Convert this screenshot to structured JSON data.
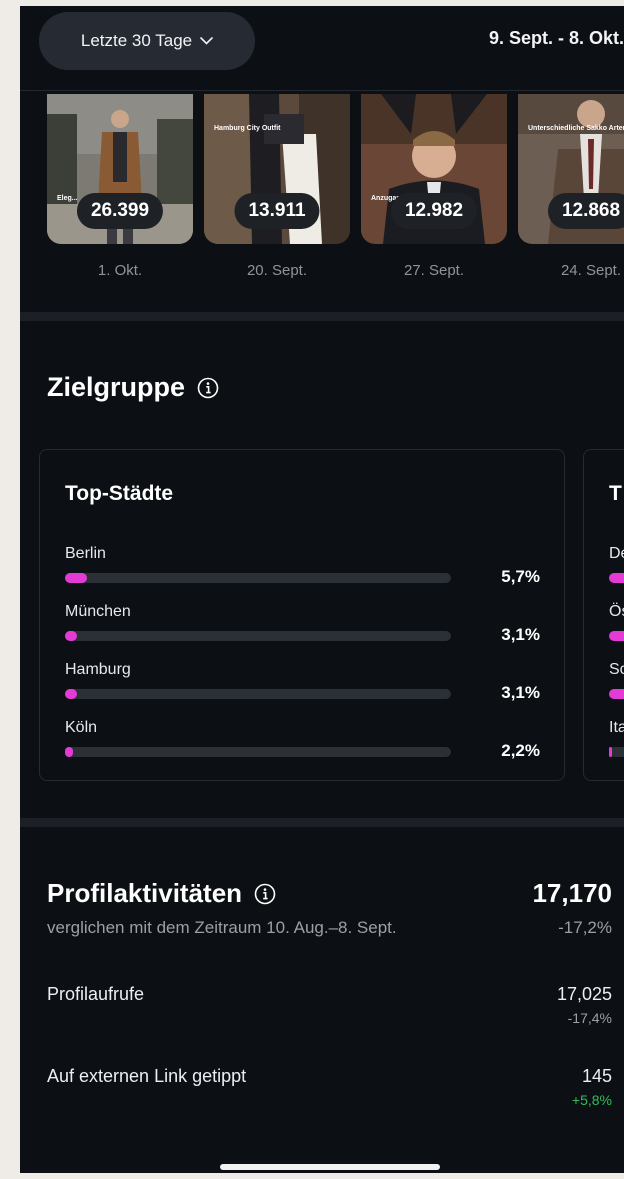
{
  "header": {
    "range_label": "Letzte 30 Tage",
    "date_range": "9. Sept. - 8. Okt."
  },
  "reels": [
    {
      "views": "26.399",
      "date": "1. Okt.",
      "caption": "Eleg..."
    },
    {
      "views": "13.911",
      "date": "20. Sept.",
      "caption": "Hamburg City Outfit"
    },
    {
      "views": "12.982",
      "date": "27. Sept.",
      "caption": "Anzuganalyse Neal Caffrey"
    },
    {
      "views": "12.868",
      "date": "24. Sept.",
      "caption": "Unterschiedliche Sakko Arten erklärt"
    }
  ],
  "audience": {
    "title": "Zielgruppe",
    "top_cities": {
      "title": "Top-Städte",
      "rows": [
        {
          "label": "Berlin",
          "pct": "5,7%",
          "value": 5.7
        },
        {
          "label": "München",
          "pct": "3,1%",
          "value": 3.1
        },
        {
          "label": "Hamburg",
          "pct": "3,1%",
          "value": 3.1
        },
        {
          "label": "Köln",
          "pct": "2,2%",
          "value": 2.2
        }
      ]
    },
    "second_card": {
      "title_partial": "T",
      "row_labels_partial": [
        "De",
        "Ös",
        "Sc",
        "Ita"
      ]
    }
  },
  "profile_activity": {
    "title": "Profilaktivitäten",
    "total": "17,170",
    "compare_text": "verglichen mit dem Zeitraum 10. Aug.–8. Sept.",
    "change": "-17,2%",
    "metrics": [
      {
        "label": "Profilaufrufe",
        "value": "17,025",
        "delta": "-17,4%",
        "delta_color": "#9aa0a8"
      },
      {
        "label": "Auf externen Link getippt",
        "value": "145",
        "delta": "+5,8%",
        "delta_color": "#2fbf5a"
      }
    ]
  },
  "colors": {
    "accent": "#e43ad6",
    "background": "#0c1014",
    "positive": "#2fbf5a"
  }
}
